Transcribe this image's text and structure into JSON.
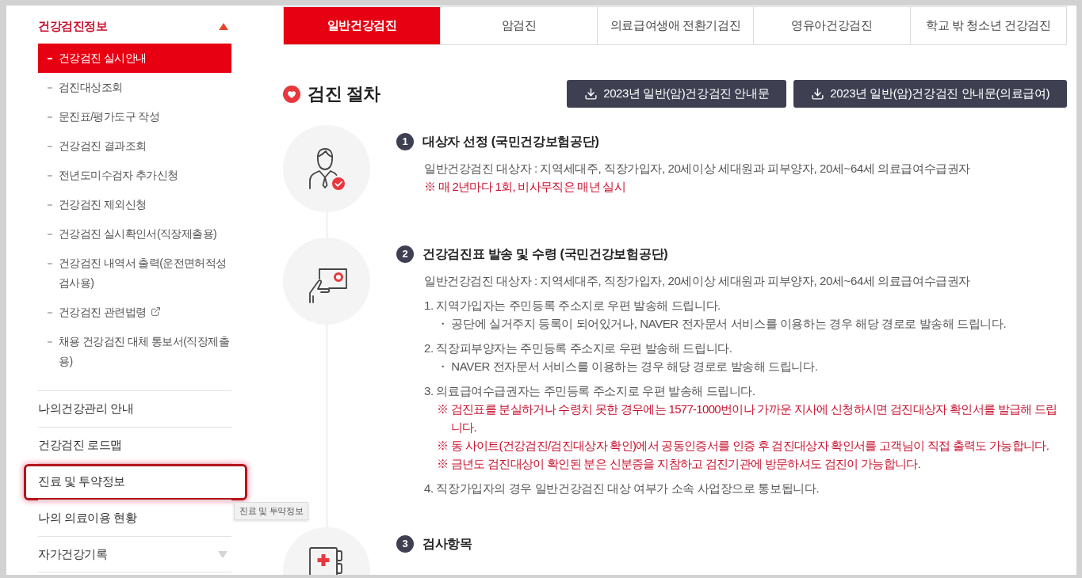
{
  "sidebar": {
    "section": {
      "title": "건강검진정보",
      "expanded": true,
      "items": [
        {
          "label": "건강검진 실시안내",
          "selected": true,
          "external": false
        },
        {
          "label": "검진대상조회",
          "selected": false,
          "external": false
        },
        {
          "label": "문진표/평가도구 작성",
          "selected": false,
          "external": false
        },
        {
          "label": "건강검진 결과조회",
          "selected": false,
          "external": false
        },
        {
          "label": "전년도미수검자 추가신청",
          "selected": false,
          "external": false
        },
        {
          "label": "건강검진 제외신청",
          "selected": false,
          "external": false
        },
        {
          "label": "건강검진 실시확인서(직장제출용)",
          "selected": false,
          "external": false
        },
        {
          "label": "건강검진 내역서 출력(운전면허적성검사용)",
          "selected": false,
          "external": false
        },
        {
          "label": "건강검진 관련법령",
          "selected": false,
          "external": true
        },
        {
          "label": "채용 건강검진 대체 통보서(직장제출용)",
          "selected": false,
          "external": false
        }
      ]
    },
    "menus": [
      {
        "label": "나의건강관리 안내",
        "kind": "link",
        "highlighted": false
      },
      {
        "label": "건강검진 로드맵",
        "kind": "link",
        "highlighted": false
      },
      {
        "label": "진료 및 투약정보",
        "kind": "link",
        "highlighted": true
      },
      {
        "label": "나의 의료이용 현황",
        "kind": "link",
        "highlighted": false
      },
      {
        "label": "자가건강기록",
        "kind": "group",
        "expanded": false,
        "highlighted": false
      }
    ]
  },
  "tooltip": {
    "text": "진료 및 투약정보"
  },
  "tabs": [
    {
      "label": "일반건강검진",
      "selected": true
    },
    {
      "label": "암검진",
      "selected": false
    },
    {
      "label": "의료급여생애 전환기검진",
      "selected": false
    },
    {
      "label": "영유아건강검진",
      "selected": false
    },
    {
      "label": "학교 밖 청소년 건강검진",
      "selected": false
    }
  ],
  "section": {
    "title": "검진 절차",
    "buttons": [
      "2023년 일반(암)건강검진 안내문",
      "2023년 일반(암)건강검진 안내문(의료급여)"
    ]
  },
  "steps": [
    {
      "number": "1",
      "title": "대상자 선정 (국민건강보험공단)",
      "lines": [
        {
          "kind": "text",
          "text": "일반건강검진 대상자 : 지역세대주, 직장가입자, 20세이상 세대원과 피부양자, 20세~64세 의료급여수급권자"
        },
        {
          "kind": "note",
          "text": "※ 매 2년마다 1회, 비사무직은 매년 실시"
        }
      ]
    },
    {
      "number": "2",
      "title": "건강검진표 발송 및 수령 (국민건강보험공단)",
      "lines": [
        {
          "kind": "text",
          "text": "일반건강검진 대상자 : 지역세대주, 직장가입자, 20세이상 세대원과 피부양자, 20세~64세 의료급여수급권자"
        },
        {
          "kind": "numbered",
          "text": "1. 지역가입자는 주민등록 주소지로 우편 발송해 드립니다.",
          "children": [
            {
              "kind": "bullet",
              "text": "・ 공단에 실거주지 등록이 되어있거나, NAVER 전자문서 서비스를 이용하는 경우 해당 경로로 발송해 드립니다."
            }
          ]
        },
        {
          "kind": "numbered",
          "text": "2. 직장피부양자는 주민등록 주소지로 우편 발송해 드립니다.",
          "children": [
            {
              "kind": "bullet",
              "text": "・ NAVER 전자문서 서비스를 이용하는 경우 해당 경로로 발송해 드립니다."
            }
          ]
        },
        {
          "kind": "numbered",
          "text": "3. 의료급여수급권자는 주민등록 주소지로 우편 발송해 드립니다.",
          "children": [
            {
              "kind": "note",
              "text": "※ 검진표를 분실하거나 수령치 못한 경우에는 1577-1000번이나 가까운 지사에 신청하시면 검진대상자 확인서를 발급해 드립니다."
            },
            {
              "kind": "note",
              "text": "※ 동 사이트(건강검진/검진대상자 확인)에서 공동인증서를 인증 후 검진대상자 확인서를 고객님이 직접 출력도 가능합니다."
            },
            {
              "kind": "note",
              "text": "※ 금년도 검진대상이 확인된 분은 신분증을 지참하고 검진기관에 방문하셔도 검진이 가능합니다."
            }
          ]
        },
        {
          "kind": "numbered",
          "text": "4. 직장가입자의 경우 일반건강검진 대상 여부가 소속 사업장으로 통보됩니다."
        }
      ]
    },
    {
      "number": "3",
      "title": "검사항목"
    }
  ]
}
